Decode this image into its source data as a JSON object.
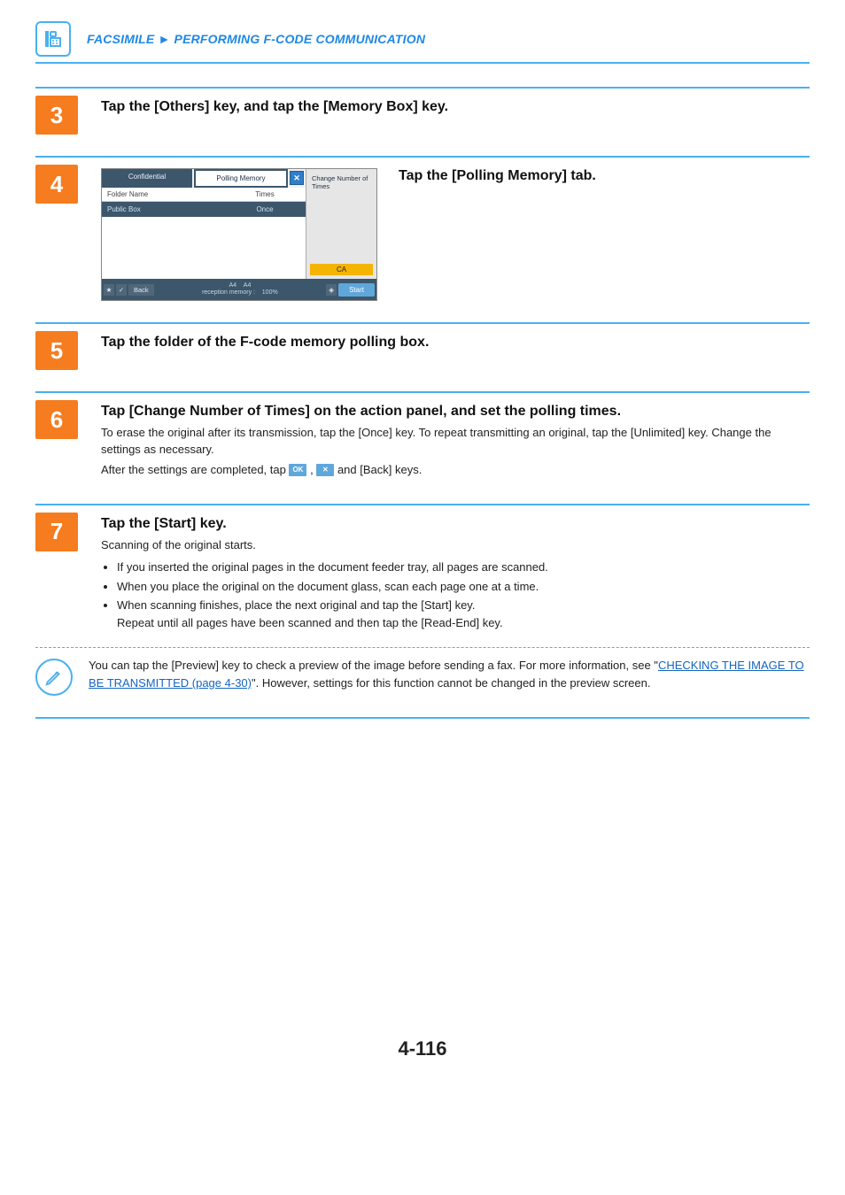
{
  "header": {
    "section": "FACSIMILE",
    "subsection": "PERFORMING F-CODE COMMUNICATION"
  },
  "steps": {
    "s3": {
      "num": "3",
      "title": "Tap the [Others] key, and tap the [Memory Box] key."
    },
    "s4": {
      "num": "4",
      "title": "Tap the [Polling Memory] tab.",
      "tabs": {
        "confidential": "Confidential",
        "polling": "Polling Memory"
      },
      "columns": {
        "name": "Folder Name",
        "times": "Times"
      },
      "row": {
        "name": "Public Box",
        "times": "Once"
      },
      "action": "Change Number of Times",
      "ca": "CA",
      "bottom": {
        "back": "Back",
        "paper1": "A4",
        "paper2": "A4",
        "mem_label": "reception memory :",
        "mem_val": "100%",
        "start": "Start"
      }
    },
    "s5": {
      "num": "5",
      "title": "Tap the folder of the F-code memory polling box."
    },
    "s6": {
      "num": "6",
      "title": "Tap [Change Number of Times] on the action panel, and set the polling times.",
      "line1": "To erase the original after its transmission, tap the [Once] key. To repeat transmitting an original, tap the [Unlimited] key. Change the settings as necessary.",
      "line2a": "After the settings are completed, tap ",
      "ok_label": "OK",
      "x_label": "✕",
      "line2b": ",  ",
      "line2c": "  and [Back] keys."
    },
    "s7": {
      "num": "7",
      "title": "Tap the [Start] key.",
      "sub": "Scanning of the original starts.",
      "b1": "If you inserted the original pages in the document feeder tray, all pages are scanned.",
      "b2": "When you place the original on the document glass, scan each page one at a time.",
      "b3a": "When scanning finishes, place the next original and tap the [Start] key.",
      "b3b": "Repeat until all pages have been scanned and then tap the [Read-End] key."
    }
  },
  "note": {
    "pre": "You can tap the [Preview] key to check a preview of the image before sending a fax. For more information, see \"",
    "link": "CHECKING THE IMAGE TO BE TRANSMITTED (page 4-30)",
    "post": "\". However, settings for this function cannot be changed in the preview screen."
  },
  "page_number": "4-116"
}
